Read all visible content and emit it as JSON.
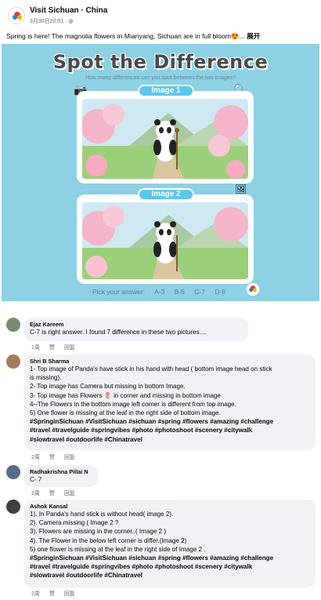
{
  "post": {
    "page_name": "Visit Sichuan · China",
    "timestamp": "3月30日20:01 ·",
    "privacy_icon": "globe-icon",
    "caption": "Spring is here! The magnolia flowers in Mianyang, Sichuan are in full bloom😍...",
    "see_more": "展开"
  },
  "image": {
    "title": "Spot the Difference",
    "subtitle": "How many differences can you spot between the two images?",
    "image1_label": "Image 1",
    "image2_label": "Image 2",
    "answer_prompt": "Pick your answer:",
    "options": [
      "A-3",
      "B-5",
      "C-7",
      "D-9"
    ]
  },
  "comments": [
    {
      "name": "Ejaz Kareem",
      "lines": [
        "C-7 is right answer. I found 7 difference in these two pictures...."
      ],
      "tag_lines": [],
      "time": "1周",
      "like": "赞",
      "reply": "回复"
    },
    {
      "name": "Shri B Sharma",
      "lines": [
        "1- Top image of Panda's have stick in his hand with head ( bottom image head on stick",
        "is missing).",
        "2- Top image has Camera but missing in bottom Image.",
        "3- Top image has Flowers 🌷 in corner and missing in bottom image",
        "4--The Flowers in the bottom image left corner is different from top image.",
        "5) One flower is missing at the leaf in the right side of bottom image."
      ],
      "tag_lines": [
        "#SpringinSichuan #VisitSichuan #sichuan #spring #flowers #amazing #challenge",
        "#travel #travelguide #springvibes #photo #photoshoot #scenery #citywalk",
        "#slowtravel #outdoorlife #Chinatravel"
      ],
      "time": "2周",
      "like": "赞",
      "reply": "回复"
    },
    {
      "name": "Radhakrishna Pillai N",
      "lines": [
        "C- 7"
      ],
      "tag_lines": [],
      "time": "2周",
      "like": "赞",
      "reply": "回复"
    },
    {
      "name": "Ashok Kansal",
      "lines": [
        "1). In Panda's hand stick is without head( image 2).",
        "2). Camera missing ( Image 2 ?",
        "3). Flowers are missing in the corner..( Image 2 )",
        "4). The Flower in the below left corner is differ.(Image 2)",
        "5) one flower is missing at the leaf in the right side of Image 2 ."
      ],
      "tag_lines": [
        "#SpringinSichuan #VisitSichuan #sichuan #spring #flowers #amazing #challenge",
        "#travel #travelguide #springvibes #photo #photoshoot #scenery #citywalk",
        "#slowtravel #outdoorlife #Chinatravel"
      ],
      "time": "2周",
      "like": "赞",
      "reply": "回复"
    }
  ],
  "colors": {
    "image_bg": "#8ed0e4",
    "pill": "#5ec6e8",
    "bubble": "#f0f2f5",
    "meta_text": "#65676b"
  }
}
